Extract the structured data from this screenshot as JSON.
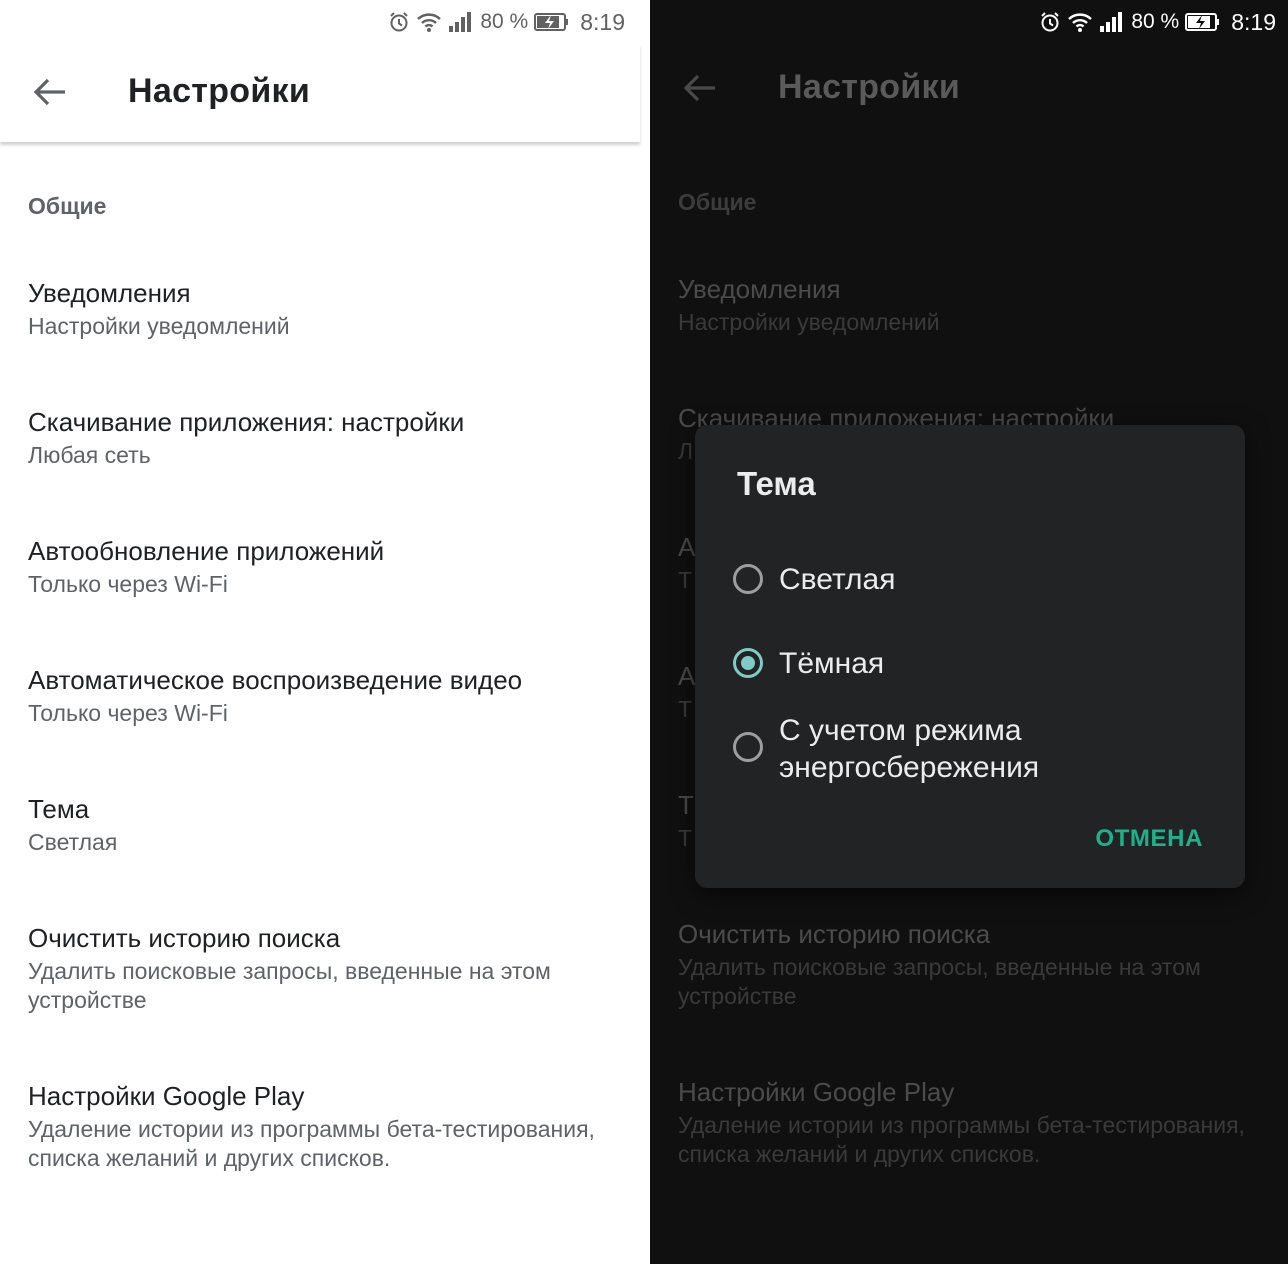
{
  "status": {
    "battery": "80 %",
    "time": "8:19"
  },
  "light": {
    "title": "Настройки",
    "section": "Общие",
    "items": [
      {
        "title": "Уведомления",
        "subtitle": "Настройки уведомлений"
      },
      {
        "title": "Скачивание приложения: настройки",
        "subtitle": "Любая сеть"
      },
      {
        "title": "Автообновление приложений",
        "subtitle": "Только через Wi-Fi"
      },
      {
        "title": "Автоматическое воспроизведение видео",
        "subtitle": "Только через Wi-Fi"
      },
      {
        "title": "Тема",
        "subtitle": "Светлая"
      },
      {
        "title": "Очистить историю поиска",
        "subtitle": "Удалить поисковые запросы, введенные на этом устройстве"
      },
      {
        "title": "Настройки Google Play",
        "subtitle": "Удаление истории из программы бета-тестирования, списка желаний и других списков."
      }
    ]
  },
  "dark": {
    "title": "Настройки",
    "section": "Общие",
    "items": [
      {
        "title": "Уведомления",
        "subtitle": "Настройки уведомлений"
      },
      {
        "title": "Скачивание приложения: настройки",
        "subtitle": "Л"
      },
      {
        "title": "А",
        "subtitle": "Т"
      },
      {
        "title": "А",
        "subtitle": "Т"
      },
      {
        "title": "Т",
        "subtitle": "Т"
      },
      {
        "title": "Очистить историю поиска",
        "subtitle": "Удалить поисковые запросы, введенные на этом устройстве"
      },
      {
        "title": "Настройки Google Play",
        "subtitle": "Удаление истории из программы бета-тестирования, списка желаний и других списков."
      }
    ],
    "dialog": {
      "title": "Тема",
      "options": [
        {
          "label": "Светлая",
          "selected": false
        },
        {
          "label": "Тёмная",
          "selected": true
        },
        {
          "label": "С учетом режима энергосбережения",
          "selected": false
        }
      ],
      "cancel": "ОТМЕНА"
    }
  },
  "icons": {
    "alarm": "alarm-icon",
    "wifi": "wifi-icon",
    "signal": "signal-icon",
    "battery": "battery-charging-icon",
    "back": "back-arrow-icon"
  },
  "colors": {
    "accent": "#1db28b",
    "radio_selected": "#80cbc4",
    "dialog_bg": "#222325",
    "dark_bg": "#101010"
  }
}
